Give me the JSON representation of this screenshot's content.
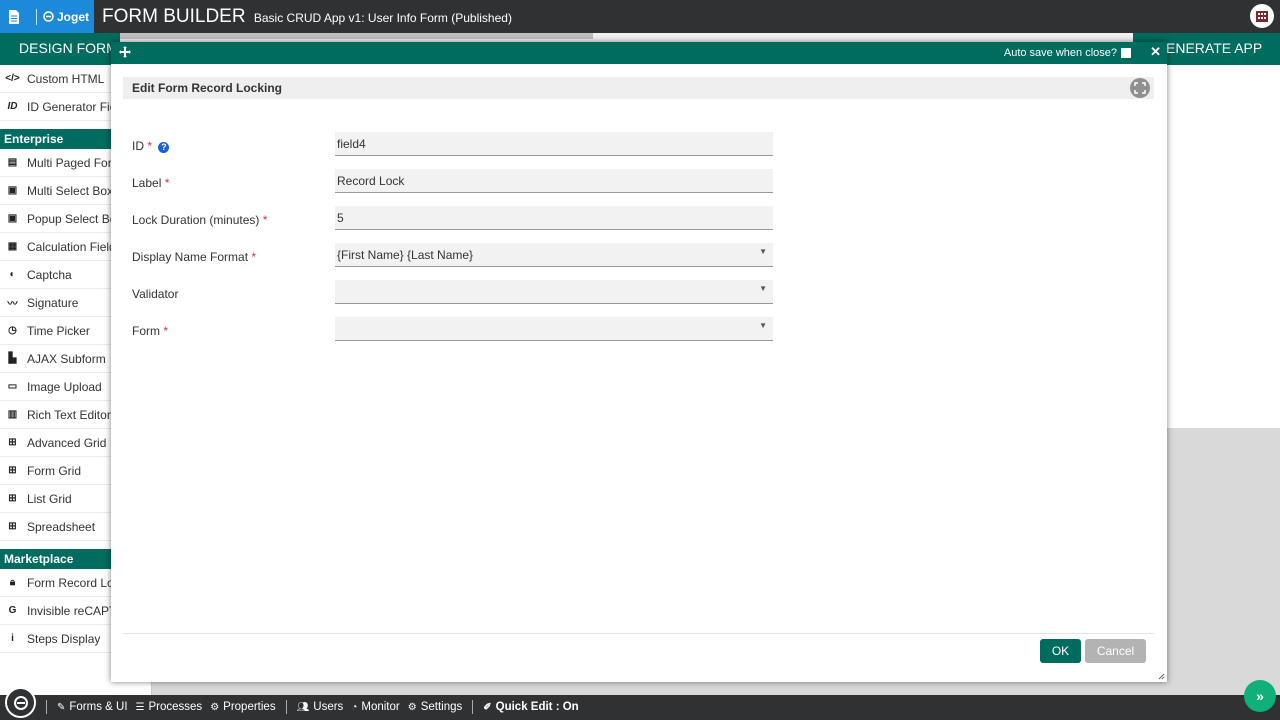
{
  "topbar": {
    "logo_text": "Joget",
    "title": "FORM BUILDER",
    "subtitle": "Basic CRUD App v1: User Info Form (Published)"
  },
  "tabs": {
    "design": "DESIGN FORM",
    "generate": "ENERATE APP"
  },
  "sidebar": {
    "top_items": [
      {
        "label": "Custom HTML",
        "icon": "code-icon"
      },
      {
        "label": "ID Generator Field",
        "icon": "id-icon"
      }
    ],
    "enterprise_header": "Enterprise",
    "enterprise_items": [
      {
        "label": "Multi Paged Form",
        "icon": "pages-icon"
      },
      {
        "label": "Multi Select Box",
        "icon": "select-icon"
      },
      {
        "label": "Popup Select Box",
        "icon": "popup-icon"
      },
      {
        "label": "Calculation Field",
        "icon": "calculator-icon"
      },
      {
        "label": "Captcha",
        "icon": "shield-icon"
      },
      {
        "label": "Signature",
        "icon": "signature-icon"
      },
      {
        "label": "Time Picker",
        "icon": "clock-icon"
      },
      {
        "label": "AJAX Subform",
        "icon": "document-icon"
      },
      {
        "label": "Image Upload",
        "icon": "image-icon"
      },
      {
        "label": "Rich Text Editor",
        "icon": "editor-icon"
      },
      {
        "label": "Advanced Grid",
        "icon": "grid-icon"
      },
      {
        "label": "Form Grid",
        "icon": "grid-icon"
      },
      {
        "label": "List Grid",
        "icon": "grid-icon"
      },
      {
        "label": "Spreadsheet",
        "icon": "grid-icon"
      }
    ],
    "marketplace_header": "Marketplace",
    "marketplace_items": [
      {
        "label": "Form Record Locking",
        "icon": "lock-icon"
      },
      {
        "label": "Invisible reCAPTCHA",
        "icon": "google-icon"
      },
      {
        "label": "Steps Display",
        "icon": "info-icon"
      }
    ]
  },
  "dialog": {
    "autosave_label": "Auto save when close?",
    "section_title": "Edit Form Record Locking",
    "fields": [
      {
        "label": "ID",
        "required": "*",
        "value": ""
      },
      {
        "label": "Label",
        "required": "*",
        "value": "Record Lock"
      },
      {
        "label": "Lock Duration (minutes)",
        "required": "*",
        "value": "5"
      },
      {
        "label": "Display Name Format",
        "required": "*",
        "value": "{First Name} {Last Name}"
      },
      {
        "label": "Validator",
        "required": "",
        "value": ""
      },
      {
        "label": "Form",
        "required": "*",
        "value": ""
      }
    ],
    "id_placeholder": "field4",
    "ok_label": "OK",
    "cancel_label": "Cancel"
  },
  "bottombar": {
    "items": [
      "Forms & UI",
      "Processes",
      "Properties",
      "Users",
      "Monitor",
      "Settings"
    ],
    "quick_edit": "Quick Edit : On"
  },
  "colors": {
    "accent": "#006b5f",
    "topbar": "#2f3133",
    "brand_blue": "#1c8ad8",
    "fab": "#0fb07a"
  }
}
